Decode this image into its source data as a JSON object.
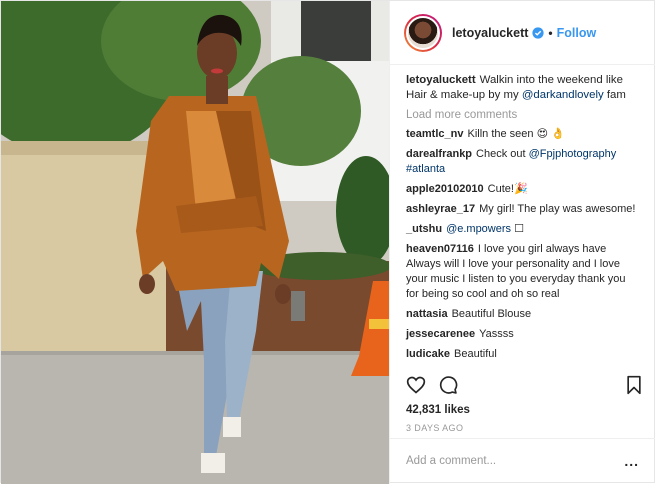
{
  "post": {
    "author": "letoyaluckett",
    "follow_label": "Follow",
    "separator": "•",
    "caption_lines": [
      "Walkin into the weekend like",
      "Hair & make-up by my",
      "@darkandlovely",
      "fam"
    ],
    "load_more": "Load more comments",
    "comments": [
      {
        "user": "teamtlc_nv",
        "text": "Killn the seen 😍 👌"
      },
      {
        "user": "darealfrankp",
        "text": "Check out",
        "mention": "@Fpjphotography",
        "mention2": "#atlanta"
      },
      {
        "user": "apple20102010",
        "text": "Cute!🎉"
      },
      {
        "user": "ashleyrae_17",
        "text": "My girl! The play was awesome!"
      },
      {
        "user": "_utshu",
        "mention": "@e.mpowers",
        "text": "☐"
      },
      {
        "user": "heaven07116",
        "text": "I love you girl always have Always will I love your personality and I love your music I listen to you everyday thank you for being so cool and oh so real"
      },
      {
        "user": "nattasia",
        "text": "Beautiful Blouse"
      },
      {
        "user": "jessecarenee",
        "text": "Yassss"
      },
      {
        "user": "ludicake",
        "text": "Beautiful"
      }
    ],
    "likes": "42,831 likes",
    "time": "3 DAYS AGO",
    "add_comment_placeholder": "Add a comment...",
    "more_label": "..."
  },
  "icons": {
    "like": "heart-icon",
    "comment": "comment-bubble-icon",
    "save": "bookmark-icon",
    "verified": "verified-badge-icon"
  },
  "colors": {
    "link": "#3897f0",
    "mention": "#003569",
    "muted": "#999999",
    "text": "#262626"
  }
}
